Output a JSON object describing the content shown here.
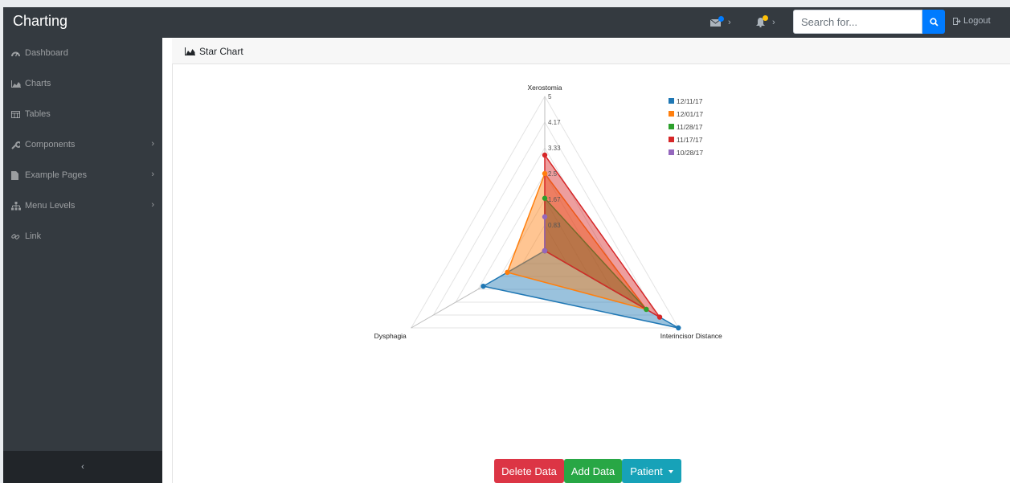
{
  "navbar": {
    "brand": "Charting",
    "messages_icon": "envelope-icon",
    "alerts_icon": "bell-icon",
    "search_placeholder": "Search for...",
    "search_button_icon": "search-icon",
    "logout_label": "Logout",
    "colors": {
      "messages_dot": "#007bff",
      "alerts_dot": "#ffc107"
    }
  },
  "sidebar": {
    "items": [
      {
        "label": "Dashboard",
        "icon": "tachometer-icon",
        "has_submenu": false
      },
      {
        "label": "Charts",
        "icon": "area-chart-icon",
        "has_submenu": false
      },
      {
        "label": "Tables",
        "icon": "table-icon",
        "has_submenu": false
      },
      {
        "label": "Components",
        "icon": "wrench-icon",
        "has_submenu": true
      },
      {
        "label": "Example Pages",
        "icon": "file-icon",
        "has_submenu": true
      },
      {
        "label": "Menu Levels",
        "icon": "sitemap-icon",
        "has_submenu": true
      },
      {
        "label": "Link",
        "icon": "link-icon",
        "has_submenu": false
      }
    ],
    "toggler": "‹"
  },
  "card": {
    "header_title": "Star Chart",
    "header_icon": "area-chart-icon"
  },
  "chart_data": {
    "type": "radar",
    "axes": [
      "Xerostomia",
      "Interincisor Distance",
      "Dysphagia"
    ],
    "rmax": 5,
    "ticks": [
      "0.83",
      "1.67",
      "2.5",
      "3.33",
      "4.17",
      "5"
    ],
    "grid": true,
    "legend_position": "top-right",
    "series": [
      {
        "name": "12/11/17",
        "color": "#1f77b4",
        "values": [
          0,
          5,
          2.3
        ]
      },
      {
        "name": "12/01/17",
        "color": "#ff7f0e",
        "values": [
          2.5,
          3.8,
          1.4
        ]
      },
      {
        "name": "11/28/17",
        "color": "#2ca02c",
        "values": [
          1.7,
          3.8,
          0
        ]
      },
      {
        "name": "11/17/17",
        "color": "#d62728",
        "values": [
          3.1,
          4.3,
          0
        ]
      },
      {
        "name": "10/28/17",
        "color": "#9467bd",
        "values": [
          1.1,
          0,
          0
        ]
      }
    ]
  },
  "actions": {
    "delete_label": "Delete Data",
    "add_label": "Add Data",
    "patient_label": "Patient",
    "colors": {
      "delete": "#dc3545",
      "add": "#28a745",
      "patient": "#17a2b8"
    }
  }
}
